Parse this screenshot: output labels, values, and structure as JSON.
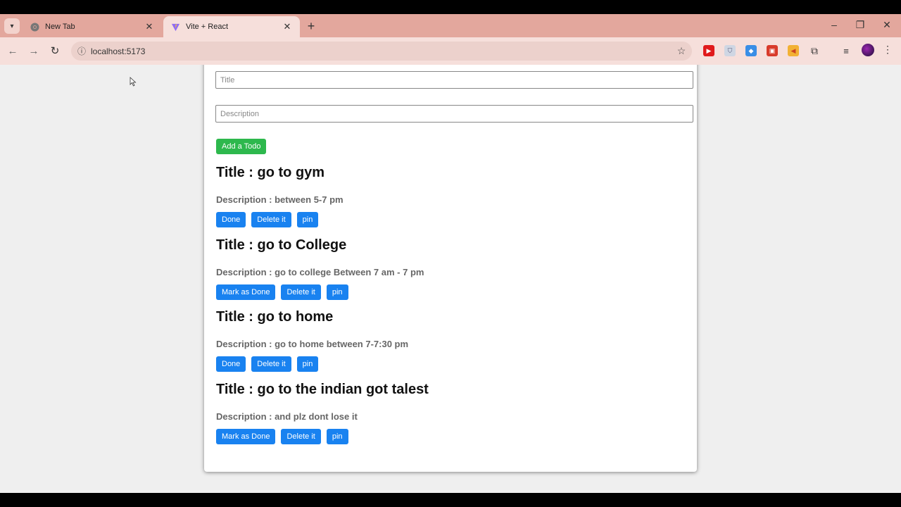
{
  "browser": {
    "tabs": [
      {
        "label": "New Tab",
        "icon": "chrome-icon"
      },
      {
        "label": "Vite + React",
        "icon": "vite-icon"
      }
    ],
    "url": "localhost:5173"
  },
  "form": {
    "title_placeholder": "Title",
    "description_placeholder": "Description",
    "add_button_label": "Add a Todo"
  },
  "todos": [
    {
      "title": "Title : go to gym",
      "description": "Description : between 5-7 pm",
      "done_label": "Done",
      "delete_label": "Delete it",
      "pin_label": "pin"
    },
    {
      "title": "Title : go to College",
      "description": "Description : go to college Between 7 am - 7 pm",
      "done_label": "Mark as Done",
      "delete_label": "Delete it",
      "pin_label": "pin"
    },
    {
      "title": "Title : go to home",
      "description": "Description : go to home between 7-7:30 pm",
      "done_label": "Done",
      "delete_label": "Delete it",
      "pin_label": "pin"
    },
    {
      "title": "Title : go to the indian got talest",
      "description": "Description : and plz dont lose it",
      "done_label": "Mark as Done",
      "delete_label": "Delete it",
      "pin_label": "pin"
    }
  ],
  "colors": {
    "add_button": "#2db84d",
    "action_button": "#1982f0",
    "tab_strip": "#e3a79d"
  }
}
